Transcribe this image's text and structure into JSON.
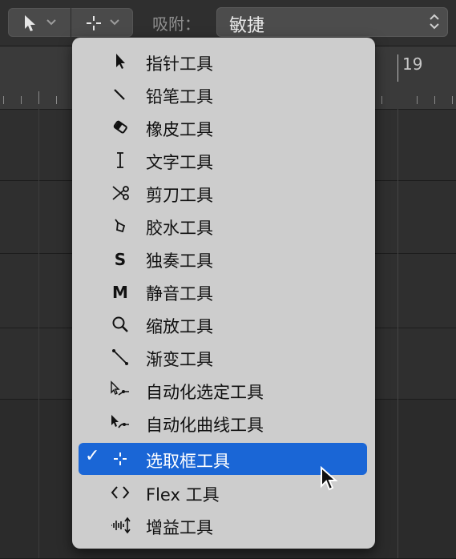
{
  "toolbar": {
    "left_tool_icon": "pointer-arrow-icon",
    "right_tool_icon": "marquee-crosshair-icon",
    "snap_label": "吸附：",
    "snap_value": "敏捷"
  },
  "ruler": {
    "bar_number": "19"
  },
  "menu": {
    "items": [
      {
        "label": "指针工具",
        "icon": "pointer-icon"
      },
      {
        "label": "铅笔工具",
        "icon": "pencil-icon"
      },
      {
        "label": "橡皮工具",
        "icon": "eraser-icon"
      },
      {
        "label": "文字工具",
        "icon": "text-cursor-icon"
      },
      {
        "label": "剪刀工具",
        "icon": "scissors-icon"
      },
      {
        "label": "胶水工具",
        "icon": "glue-icon"
      },
      {
        "label": "独奏工具",
        "icon": "solo-icon",
        "glyph": "S"
      },
      {
        "label": "静音工具",
        "icon": "mute-icon",
        "glyph": "M"
      },
      {
        "label": "缩放工具",
        "icon": "zoom-icon"
      },
      {
        "label": "渐变工具",
        "icon": "fade-icon"
      },
      {
        "label": "自动化选定工具",
        "icon": "automation-select-icon"
      },
      {
        "label": "自动化曲线工具",
        "icon": "automation-curve-icon"
      },
      {
        "label": "选取框工具",
        "icon": "marquee-icon",
        "selected": true
      },
      {
        "label": "Flex 工具",
        "icon": "flex-icon"
      },
      {
        "label": "增益工具",
        "icon": "gain-icon"
      }
    ],
    "check_glyph": "✓"
  },
  "colors": {
    "selection": "#1a66d6",
    "menu_bg": "#cdcdcd"
  }
}
